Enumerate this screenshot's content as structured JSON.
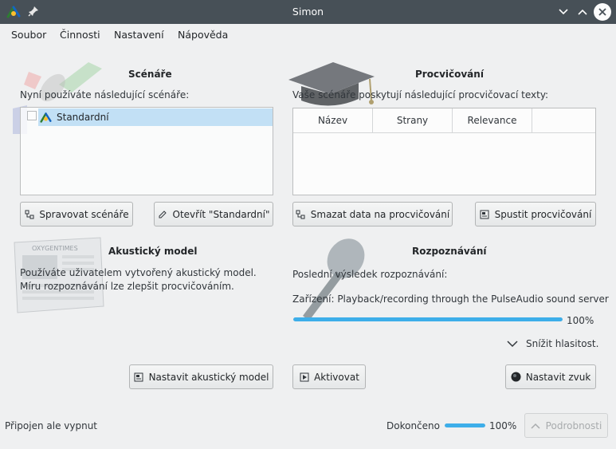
{
  "window": {
    "title": "Simon"
  },
  "menu": [
    "Soubor",
    "Činnosti",
    "Nastavení",
    "Nápověda"
  ],
  "scenarios": {
    "title": "Scénáře",
    "description": "Nyní používáte následující scénáře:",
    "items": [
      "Standardní"
    ],
    "manage_button": "Spravovat scénáře",
    "open_button": "Otevřít \"Standardní\""
  },
  "training": {
    "title": "Procvičování",
    "description": "Vaše scénáře poskytují následující procvičovací texty:",
    "columns": [
      "Název",
      "Strany",
      "Relevance"
    ],
    "clear_button": "Smazat data na procvičování",
    "start_button": "Spustit procvičování"
  },
  "acoustic": {
    "title": "Akustický model",
    "line1": "Používáte uživatelem vytvořený akustický model.",
    "line2": "Míru rozpoznávání lze zlepšit procvičováním.",
    "set_button": "Nastavit akustický model",
    "newspaper_label": "OXYGENTIMES"
  },
  "recognition": {
    "title": "Rozpoznávání",
    "last_result": "Poslední výsledek rozpoznávání:",
    "device": "Zařízení: Playback/recording through the PulseAudio sound server",
    "level": 100,
    "level_label": "100%",
    "lower_volume": "Snížit hlasitost.",
    "activate_button": "Aktivovat",
    "sound_button": "Nastavit zvuk"
  },
  "status": {
    "message": "Připojen ale vypnut",
    "done_label": "Dokončeno",
    "progress": 100,
    "progress_label": "100%",
    "details_button": "Podrobnosti"
  },
  "colors": {
    "titlebar": "#475057",
    "accent": "#3daee9",
    "selection": "#c2e0f5"
  }
}
